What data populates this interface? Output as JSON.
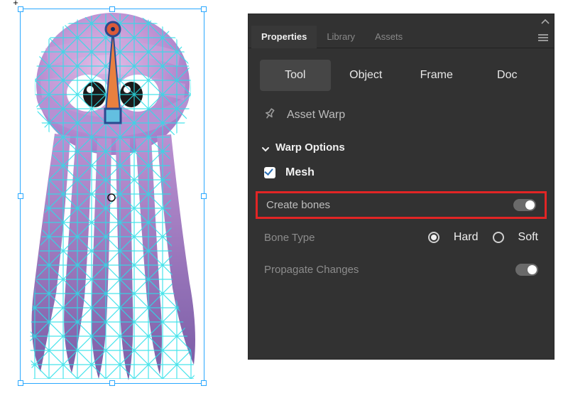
{
  "panel": {
    "tabs": {
      "properties": "Properties",
      "library": "Library",
      "assets": "Assets"
    },
    "mode_tabs": {
      "tool": "Tool",
      "object": "Object",
      "frame": "Frame",
      "doc": "Doc"
    },
    "tool_name": "Asset Warp",
    "section_title": "Warp Options",
    "mesh_label": "Mesh",
    "create_bones_label": "Create bones",
    "bone_type": {
      "label": "Bone Type",
      "hard": "Hard",
      "soft": "Soft"
    },
    "propagate_label": "Propagate Changes",
    "state": {
      "mesh_checked": true,
      "create_bones_on": true,
      "bone_type": "Hard",
      "propagate_on": true
    }
  },
  "canvas": {
    "crosshair": "+"
  }
}
